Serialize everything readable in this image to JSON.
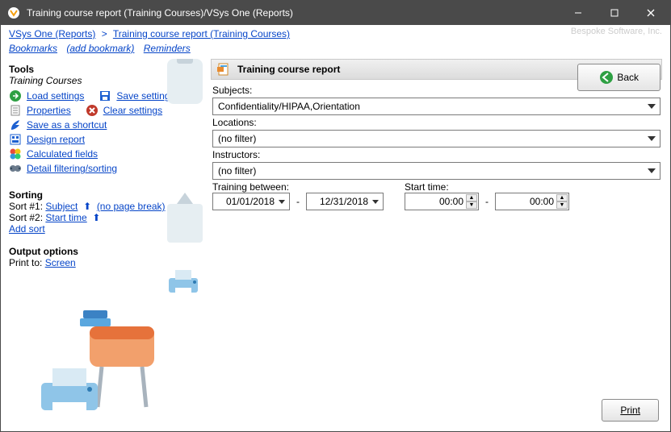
{
  "window": {
    "title": "Training course report (Training Courses)/VSys One (Reports)"
  },
  "breadcrumb": {
    "root": "VSys One (Reports)",
    "sep": ">",
    "current": "Training course report (Training Courses)"
  },
  "watermark": "Bespoke Software, Inc.",
  "linkrow": {
    "bookmarks": "Bookmarks",
    "add_bookmark": "(add bookmark)",
    "reminders": "Reminders"
  },
  "back_button": "Back",
  "tools": {
    "heading": "Tools",
    "subtitle": "Training Courses",
    "load_settings": "Load settings",
    "save_settings": "Save settings",
    "properties": "Properties",
    "clear_settings": "Clear settings",
    "save_shortcut": "Save as a shortcut",
    "design_report": "Design report",
    "calculated_fields": "Calculated fields",
    "detail_filtering": "Detail filtering/sorting"
  },
  "sorting": {
    "heading": "Sorting",
    "row1_prefix": "Sort #1: ",
    "row1_field": "Subject",
    "row1_break": "(no page break)",
    "row2_prefix": "Sort #2: ",
    "row2_field": "Start time",
    "add_sort": "Add sort"
  },
  "output": {
    "heading": "Output options",
    "prefix": "Print to:  ",
    "target": "Screen"
  },
  "panel": {
    "title": "Training course report",
    "subjects_label": "Subjects:",
    "subjects_value": "Confidentiality/HIPAA,Orientation",
    "locations_label": "Locations:",
    "locations_value": "(no filter)",
    "instructors_label": "Instructors:",
    "instructors_value": "(no filter)",
    "training_between_label": "Training between:",
    "date_from": "01/01/2018",
    "date_to": "12/31/2018",
    "start_time_label": "Start time:",
    "time_from": "00:00",
    "time_to": "00:00",
    "dash": "-"
  },
  "footer": {
    "print": "Print"
  }
}
